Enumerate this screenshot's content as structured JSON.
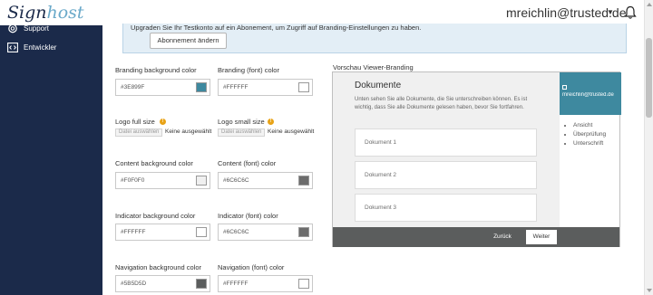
{
  "header": {
    "logo_part1": "Sign",
    "logo_part2": "host",
    "user_email": "mreichlin@trusted.de",
    "caret": "▼"
  },
  "sidebar": {
    "items": [
      {
        "label": "Support",
        "icon": "support-icon"
      },
      {
        "label": "Entwickler",
        "icon": "developer-icon"
      }
    ]
  },
  "alert": {
    "text": "Upgraden Sie Ihr Testkonto auf ein Abonement, um Zugriff auf Branding-Einstellungen zu haben.",
    "button": "Abonnement ändern"
  },
  "fields": {
    "branding_bg": {
      "label": "Branding background color",
      "value": "#3E899F",
      "swatch": "#3e899f"
    },
    "branding_font": {
      "label": "Branding (font) color",
      "value": "#FFFFFF",
      "swatch": "#ffffff"
    },
    "logo_full": {
      "label": "Logo full size",
      "button": "Datei auswählen",
      "none": "Keine ausgewählt"
    },
    "logo_small": {
      "label": "Logo small size",
      "button": "Datei auswählen",
      "none": "Keine ausgewählt"
    },
    "content_bg": {
      "label": "Content background color",
      "value": "#F0F0F0",
      "swatch": "#f0f0f0"
    },
    "content_font": {
      "label": "Content (font) color",
      "value": "#6C6C6C",
      "swatch": "#6c6c6c"
    },
    "indicator_bg": {
      "label": "Indicator background color",
      "value": "#FFFFFF",
      "swatch": "#ffffff"
    },
    "indicator_font": {
      "label": "Indicator (font) color",
      "value": "#6C6C6C",
      "swatch": "#6c6c6c"
    },
    "navigation_bg": {
      "label": "Navigation background color",
      "value": "#5B5D5D",
      "swatch": "#5b5d5d"
    },
    "navigation_font": {
      "label": "Navigation (font) color",
      "value": "#FFFFFF",
      "swatch": "#ffffff"
    }
  },
  "info_glyph": "!",
  "preview": {
    "title": "Vorschau Viewer-Branding",
    "heading": "Dokumente",
    "text": "Unten sehen Sie alle Dokumente, die Sie unterschreiben können. Es ist wichtig, dass Sie alle Dokumente gelesen haben, bevor Sie fortfahren.",
    "documents": [
      "Dokument 1",
      "Dokument 2",
      "Dokument 3"
    ],
    "nav_email": "mreichlin@trusted.de",
    "nav_items": [
      "Ansicht",
      "Überprüfung",
      "Unterschrift"
    ],
    "back": "Zurück",
    "next": "Weiter"
  },
  "colors": {
    "sidebar": "#1b2a4a",
    "accent": "#3e899f",
    "footer": "#5b5d5d"
  }
}
